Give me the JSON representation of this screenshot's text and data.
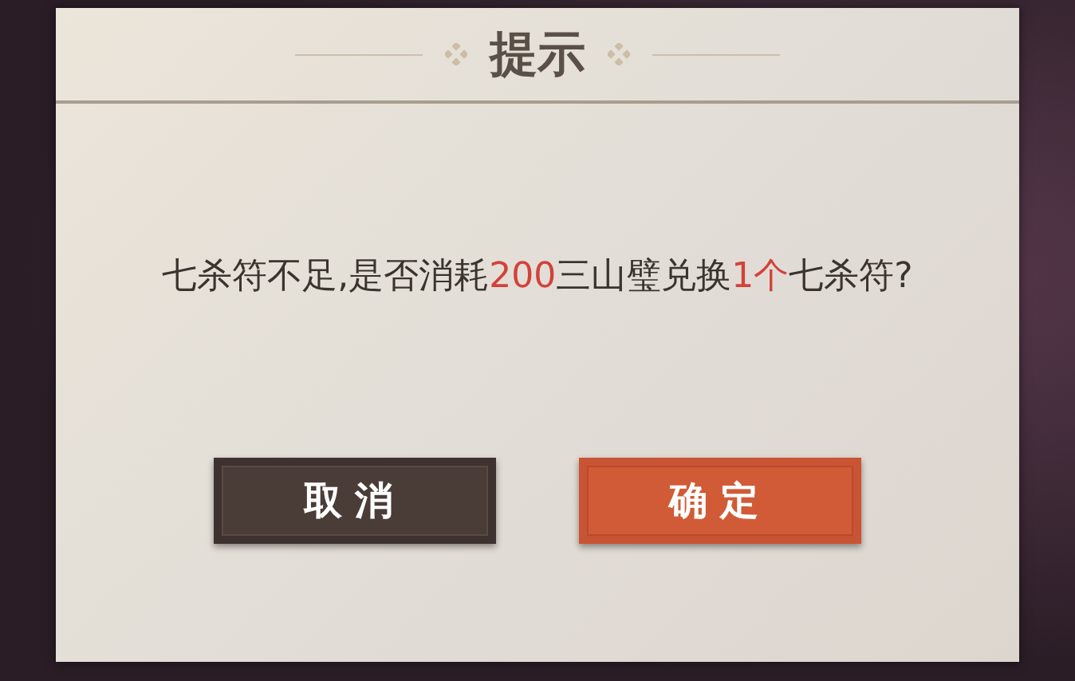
{
  "dialog": {
    "title": "提示",
    "message": [
      {
        "text": "七杀符不足,是否消耗",
        "highlight": false
      },
      {
        "text": "200",
        "highlight": true
      },
      {
        "text": "三山璧兑换",
        "highlight": false
      },
      {
        "text": "1个",
        "highlight": true
      },
      {
        "text": "七杀符?",
        "highlight": false
      }
    ],
    "buttons": [
      {
        "label": "取消",
        "kind": "secondary"
      },
      {
        "label": "确定",
        "kind": "primary"
      }
    ]
  }
}
